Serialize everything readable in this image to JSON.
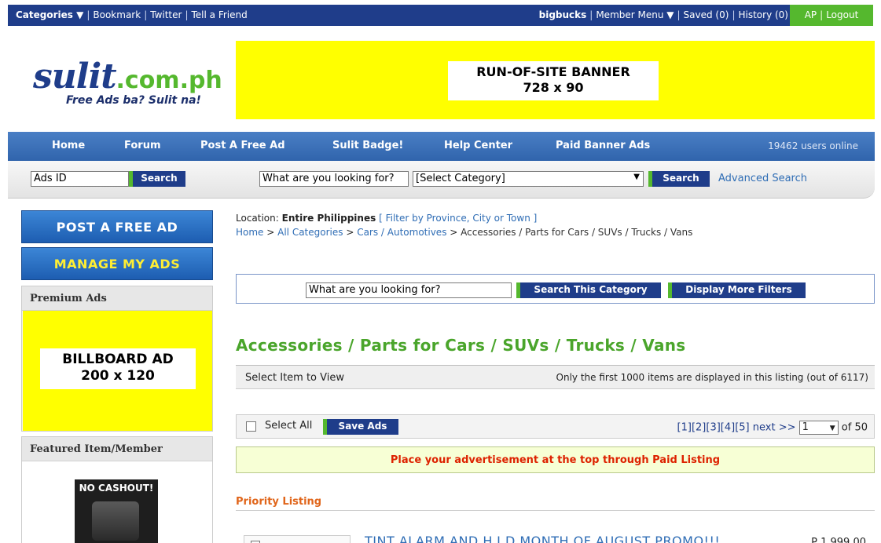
{
  "topbar": {
    "categories": "Categories ▼",
    "links": [
      "Bookmark",
      "Twitter",
      "Tell a Friend"
    ],
    "username": "bigbucks",
    "member_menu": "Member Menu ▼",
    "saved": "Saved (0)",
    "history": "History (0)",
    "ap": "AP",
    "logout": "Logout"
  },
  "logo": {
    "brand": "sulit",
    "domain": ".com.ph",
    "tagline": "Free Ads ba? Sulit na!"
  },
  "banner": {
    "line1": "RUN-OF-SITE BANNER",
    "line2": "728 x 90"
  },
  "nav": {
    "items": [
      "Home",
      "Forum",
      "Post A Free Ad",
      "Sulit Badge!",
      "Help Center",
      "Paid Banner Ads"
    ],
    "online": "19462 users online"
  },
  "search": {
    "ads_id_value": "Ads ID",
    "search_label": "Search",
    "query_value": "What are you looking for?",
    "category_value": "[Select  Category]",
    "advanced": "Advanced Search"
  },
  "sidebar": {
    "post_ad": "POST A FREE AD",
    "manage_ads": "MANAGE MY ADS",
    "premium_title": "Premium Ads",
    "billboard_line1": "BILLBOARD AD",
    "billboard_line2": "200 x 120",
    "featured_title": "Featured Item/Member",
    "featured_img_text": "NO CASHOUT!"
  },
  "location": {
    "label": "Location:",
    "value": "Entire Philippines",
    "filter": "[ Filter by Province, City or Town ]",
    "breadcrumb": [
      "Home",
      "All Categories",
      "Cars / Automotives"
    ],
    "current": "Accessories / Parts for Cars / SUVs / Trucks / Vans"
  },
  "category_search": {
    "query_value": "What are you looking for?",
    "search_button": "Search This Category",
    "filters_button": "Display More Filters"
  },
  "listing": {
    "title": "Accessories / Parts for Cars / SUVs / Trucks / Vans",
    "select_item": "Select Item to View",
    "notice": "Only the first 1000 items are displayed in this listing (out of 6117)",
    "select_all": "Select All",
    "save_ads": "Save Ads",
    "pages": [
      "[1]",
      "[2]",
      "[3]",
      "[4]",
      "[5]"
    ],
    "next": "next >>",
    "page_select": "1",
    "of_pages": "of 50",
    "paid_notice": "Place your advertisement at the top through Paid Listing",
    "priority": "Priority Listing",
    "first_item_title": "TINT ALARM AND H.I.D MONTH OF AUGUST PROMO!!!",
    "first_item_price": "P 1,999.00"
  },
  "colors": {
    "navy": "#1f3d8a",
    "green": "#55b82e",
    "banner_yellow": "#ffff00",
    "title_green": "#4aa52b",
    "paid_red": "#dd2200",
    "priority_orange": "#e0651a"
  }
}
